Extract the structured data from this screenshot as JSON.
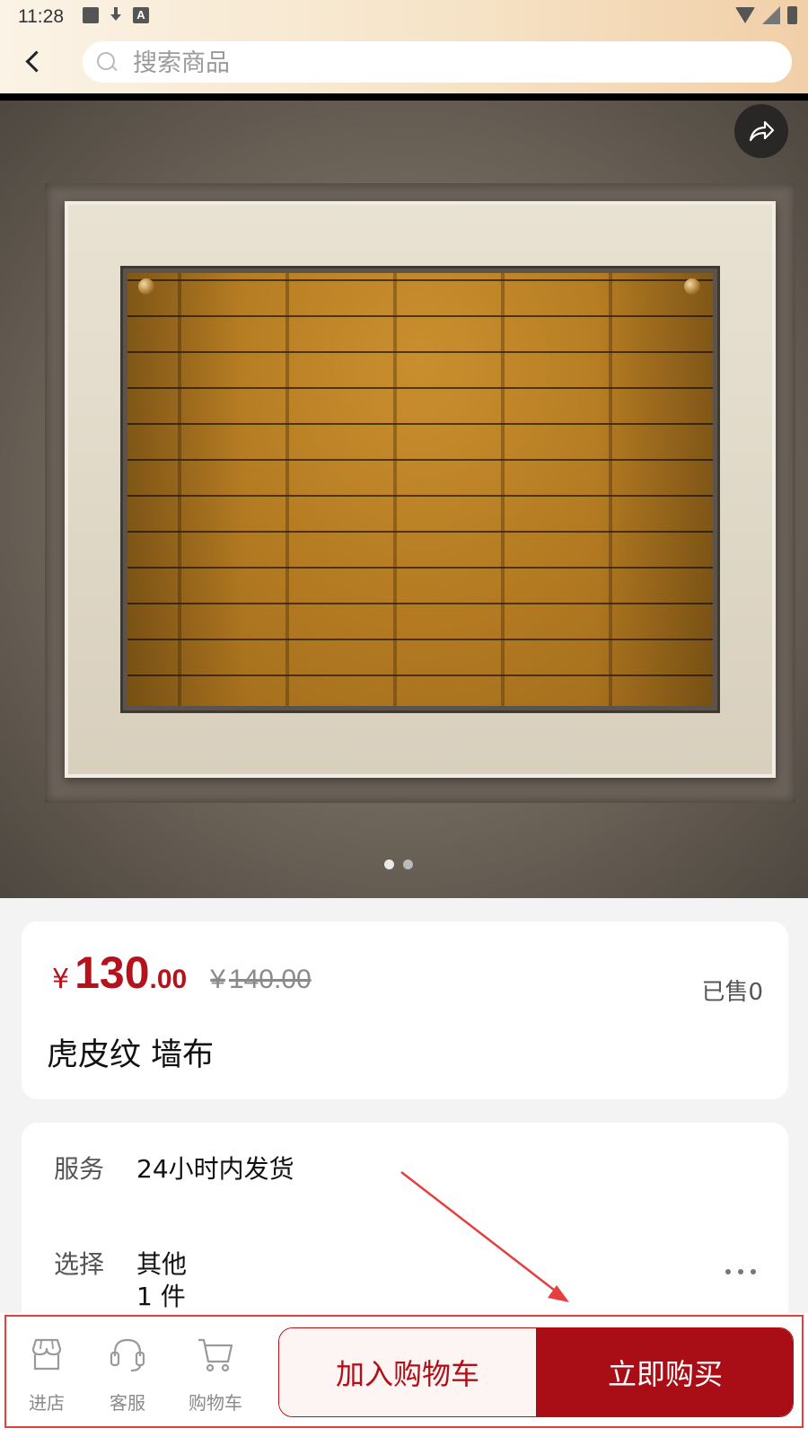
{
  "status_bar": {
    "time": "11:28",
    "a_icon_label": "A"
  },
  "header": {
    "search_placeholder": "搜索商品"
  },
  "gallery": {
    "total_images": 2,
    "active_index": 0
  },
  "product": {
    "price_symbol": "¥",
    "price_integer": "130",
    "price_decimal": ".00",
    "original_price_symbol": "¥",
    "original_price": "140.00",
    "sold": "已售0",
    "title": "虎皮纹 墙布"
  },
  "details": {
    "service_label": "服务",
    "service_value": "24小时内发货",
    "select_label": "选择",
    "select_value": "其他",
    "select_qty": "1 件"
  },
  "bottom_bar": {
    "store_label": "进店",
    "service_label": "客服",
    "cart_label": "购物车",
    "add_to_cart": "加入购物车",
    "buy_now": "立即购买"
  },
  "colors": {
    "accent": "#a90d15",
    "price": "#b5121b",
    "annotation": "#e53e3e"
  },
  "icons": [
    "back-icon",
    "search-icon",
    "share-icon",
    "more-icon",
    "store-icon",
    "headset-icon",
    "cart-icon"
  ]
}
